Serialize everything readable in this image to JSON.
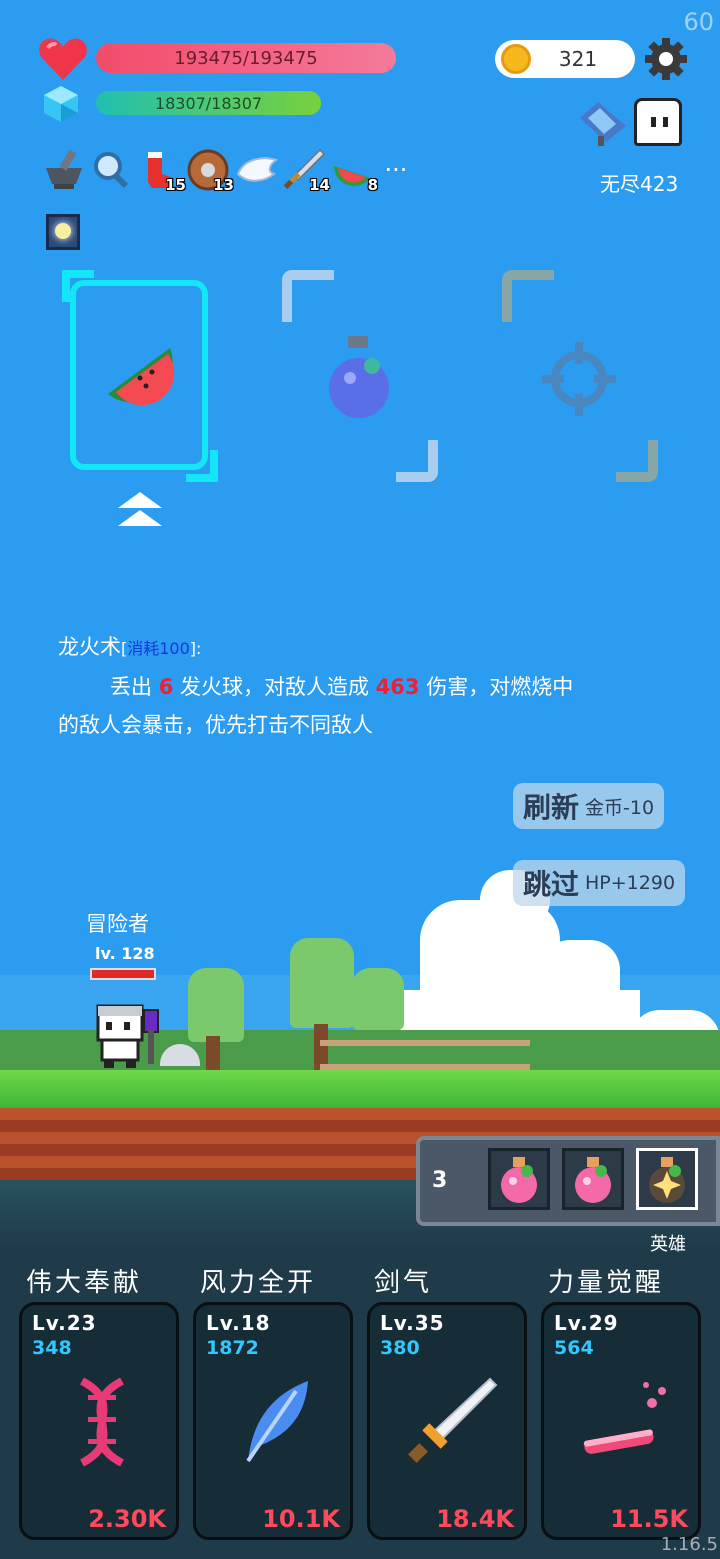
{
  "fps": "60",
  "stats": {
    "hp": "193475/193475",
    "mp": "18307/18307",
    "coins": "321"
  },
  "mode": {
    "endless_label": "无尽423"
  },
  "items": [
    {
      "icon": "mortar-icon",
      "count": ""
    },
    {
      "icon": "magnifier-icon",
      "count": ""
    },
    {
      "icon": "sock-icon",
      "count": "15"
    },
    {
      "icon": "shield-icon",
      "count": "13"
    },
    {
      "icon": "wing-icon",
      "count": ""
    },
    {
      "icon": "sword-icon",
      "count": "14"
    },
    {
      "icon": "watermelon-icon",
      "count": "8"
    }
  ],
  "items_more": "···",
  "skill": {
    "name": "龙火术",
    "cost_open": "[",
    "cost_label": "消耗100",
    "cost_close": "]:",
    "line1_a": "丢出 ",
    "fireballs": "6",
    "line1_b": " 发火球，对敌人造成 ",
    "damage": "463",
    "line1_c": " 伤害，对燃烧中",
    "line2": "的敌人会暴击，优先打击不同敌人"
  },
  "actions": {
    "refresh_label": "刷新",
    "refresh_cost": "金币-10",
    "skip_label": "跳过",
    "skip_reward": "HP+1290"
  },
  "character": {
    "name": "冒险者",
    "level": "lv. 128"
  },
  "potions": {
    "count": "3",
    "hero_label": "英雄"
  },
  "upgrades": [
    {
      "name": "伟大奉献",
      "level": "Lv.23",
      "value": "348",
      "cost": "2.30K",
      "icon": "dna-icon"
    },
    {
      "name": "风力全开",
      "level": "Lv.18",
      "value": "1872",
      "cost": "10.1K",
      "icon": "feather-icon"
    },
    {
      "name": "剑气",
      "level": "Lv.35",
      "value": "380",
      "cost": "18.4K",
      "icon": "sword-icon"
    },
    {
      "name": "力量觉醒",
      "level": "Lv.29",
      "value": "564",
      "cost": "11.5K",
      "icon": "potion-tube-icon"
    }
  ],
  "version": "1.16.5",
  "colors": {
    "sky": "#2b9cf0",
    "accent": "#12e6f7",
    "cost_red": "#ff4a5e",
    "stat_blue": "#32c8ff"
  }
}
